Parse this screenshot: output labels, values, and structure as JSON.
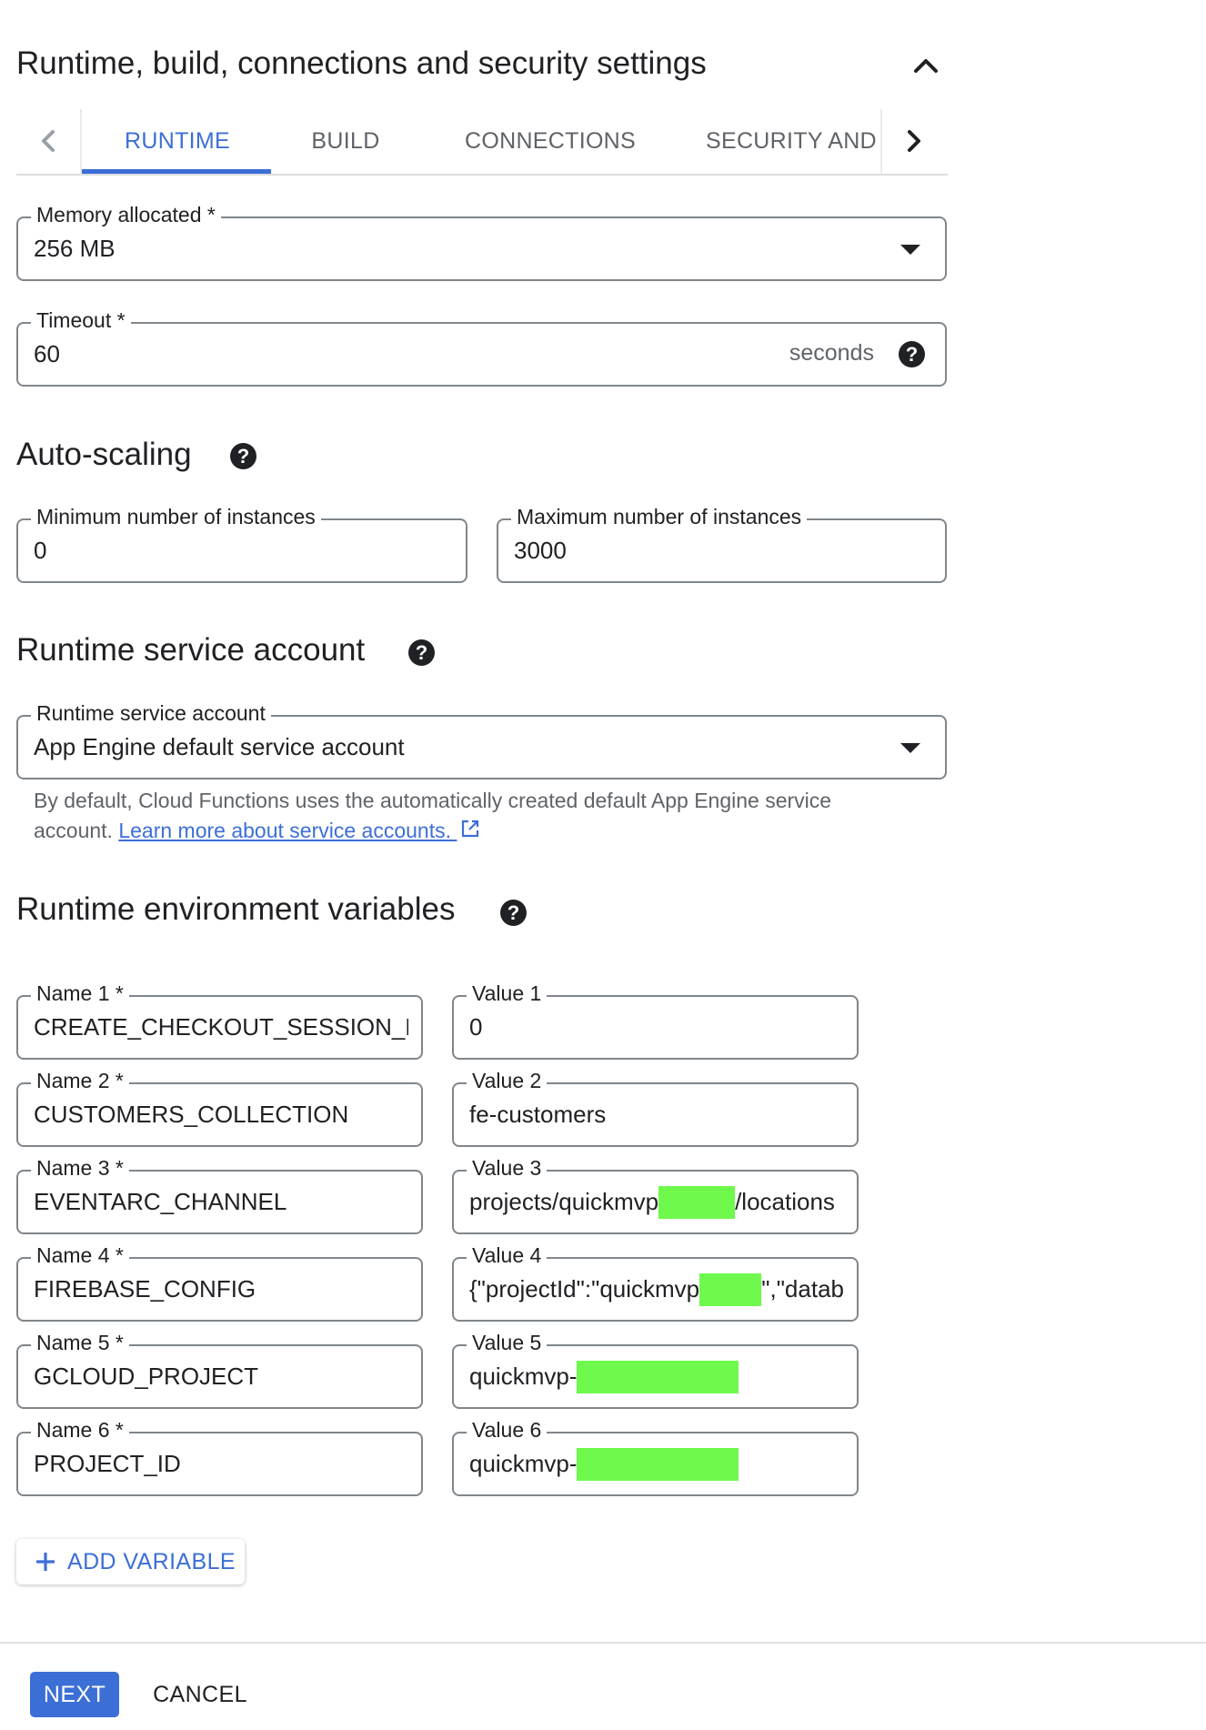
{
  "header": {
    "title": "Runtime, build, connections and security settings",
    "collapse_icon": "chevron-up-icon"
  },
  "tabs": {
    "items": [
      {
        "label": "RUNTIME",
        "active": true
      },
      {
        "label": "BUILD",
        "active": false
      },
      {
        "label": "CONNECTIONS",
        "active": false
      },
      {
        "label": "SECURITY AND",
        "active": false
      }
    ],
    "prev_icon": "chevron-left-icon",
    "next_icon": "chevron-right-icon",
    "active_color": "#3c6fd6"
  },
  "runtime": {
    "memory": {
      "label": "Memory allocated *",
      "value": "256 MB"
    },
    "timeout": {
      "label": "Timeout *",
      "value": "60",
      "suffix": "seconds"
    }
  },
  "autoscaling": {
    "title": "Auto-scaling",
    "min": {
      "label": "Minimum number of instances",
      "value": "0"
    },
    "max": {
      "label": "Maximum number of instances",
      "value": "3000"
    }
  },
  "service_account": {
    "title": "Runtime service account",
    "field": {
      "label": "Runtime service account",
      "value": "App Engine default service account"
    },
    "helper_text": "By default, Cloud Functions uses the automatically created default App Engine service account.",
    "learn_more": "Learn more about service accounts."
  },
  "env_vars": {
    "title": "Runtime environment variables",
    "rows": [
      {
        "name_label": "Name 1 *",
        "name": "CREATE_CHECKOUT_SESSION_MIN",
        "value_label": "Value 1",
        "value": "0",
        "value_after": ""
      },
      {
        "name_label": "Name 2 *",
        "name": "CUSTOMERS_COLLECTION",
        "value_label": "Value 2",
        "value": "fe-customers",
        "value_after": ""
      },
      {
        "name_label": "Name 3 *",
        "name": "EVENTARC_CHANNEL",
        "value_label": "Value 3",
        "value": "projects/quickmvp",
        "value_after": "/locations"
      },
      {
        "name_label": "Name 4 *",
        "name": "FIREBASE_CONFIG",
        "value_label": "Value 4",
        "value": "{\"projectId\":\"quickmvp",
        "value_after": "\",\"datab"
      },
      {
        "name_label": "Name 5 *",
        "name": "GCLOUD_PROJECT",
        "value_label": "Value 5",
        "value": "quickmvp-",
        "value_after": ""
      },
      {
        "name_label": "Name 6 *",
        "name": "PROJECT_ID",
        "value_label": "Value 6",
        "value": "quickmvp-",
        "value_after": ""
      }
    ],
    "add_label": "ADD VARIABLE"
  },
  "footer": {
    "next_label": "NEXT",
    "cancel_label": "CANCEL"
  },
  "colors": {
    "primary": "#3c6fd6",
    "redaction": "#6ff94d",
    "border": "#80868b"
  }
}
